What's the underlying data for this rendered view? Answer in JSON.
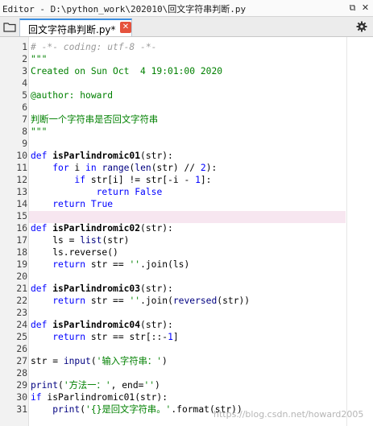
{
  "window": {
    "title": "Editor - D:\\python_work\\202010\\回文字符串判断.py",
    "undock_icon": "⧉",
    "close_icon": "✕"
  },
  "tab": {
    "label": "回文字符串判断.py*",
    "close_icon": "✕"
  },
  "icons": {
    "browse": "folder-icon",
    "options": "gear-icon"
  },
  "code": [
    {
      "n": "1",
      "segs": [
        {
          "t": "# -*- coding: utf-8 -*-",
          "c": "cm"
        }
      ]
    },
    {
      "n": "2",
      "segs": [
        {
          "t": "\"\"\"",
          "c": "st"
        }
      ]
    },
    {
      "n": "3",
      "segs": [
        {
          "t": "Created on Sun Oct  4 19:01:00 2020",
          "c": "st"
        }
      ]
    },
    {
      "n": "4",
      "segs": []
    },
    {
      "n": "5",
      "segs": [
        {
          "t": "@author: howard",
          "c": "st"
        }
      ]
    },
    {
      "n": "6",
      "segs": []
    },
    {
      "n": "7",
      "segs": [
        {
          "t": "判断一个字符串是否回文字符串",
          "c": "st"
        }
      ]
    },
    {
      "n": "8",
      "segs": [
        {
          "t": "\"\"\"",
          "c": "st"
        }
      ]
    },
    {
      "n": "9",
      "segs": []
    },
    {
      "n": "10",
      "segs": [
        {
          "t": "def ",
          "c": "kw"
        },
        {
          "t": "isParlindromic01",
          "c": "fn"
        },
        {
          "t": "(str):",
          "c": ""
        }
      ]
    },
    {
      "n": "11",
      "segs": [
        {
          "t": "    ",
          "c": ""
        },
        {
          "t": "for",
          "c": "kw"
        },
        {
          "t": " i ",
          "c": ""
        },
        {
          "t": "in",
          "c": "kw"
        },
        {
          "t": " ",
          "c": ""
        },
        {
          "t": "range",
          "c": "bi"
        },
        {
          "t": "(",
          "c": ""
        },
        {
          "t": "len",
          "c": "bi"
        },
        {
          "t": "(str) // ",
          "c": ""
        },
        {
          "t": "2",
          "c": "nm"
        },
        {
          "t": "):",
          "c": ""
        }
      ]
    },
    {
      "n": "12",
      "segs": [
        {
          "t": "        ",
          "c": ""
        },
        {
          "t": "if",
          "c": "kw"
        },
        {
          "t": " str[i] != str[-i - ",
          "c": ""
        },
        {
          "t": "1",
          "c": "nm"
        },
        {
          "t": "]:",
          "c": ""
        }
      ]
    },
    {
      "n": "13",
      "segs": [
        {
          "t": "            ",
          "c": ""
        },
        {
          "t": "return",
          "c": "kw"
        },
        {
          "t": " ",
          "c": ""
        },
        {
          "t": "False",
          "c": "kw"
        }
      ]
    },
    {
      "n": "14",
      "segs": [
        {
          "t": "    ",
          "c": ""
        },
        {
          "t": "return",
          "c": "kw"
        },
        {
          "t": " ",
          "c": ""
        },
        {
          "t": "True",
          "c": "kw"
        }
      ]
    },
    {
      "n": "15",
      "segs": []
    },
    {
      "n": "16",
      "segs": [
        {
          "t": "def ",
          "c": "kw"
        },
        {
          "t": "isParlindromic02",
          "c": "fn"
        },
        {
          "t": "(str):",
          "c": ""
        }
      ]
    },
    {
      "n": "17",
      "segs": [
        {
          "t": "    ls = ",
          "c": ""
        },
        {
          "t": "list",
          "c": "bi"
        },
        {
          "t": "(str)",
          "c": ""
        }
      ]
    },
    {
      "n": "18",
      "segs": [
        {
          "t": "    ls.reverse()",
          "c": ""
        }
      ]
    },
    {
      "n": "19",
      "segs": [
        {
          "t": "    ",
          "c": ""
        },
        {
          "t": "return",
          "c": "kw"
        },
        {
          "t": " str == ",
          "c": ""
        },
        {
          "t": "''",
          "c": "st"
        },
        {
          "t": ".join(ls)",
          "c": ""
        }
      ]
    },
    {
      "n": "20",
      "segs": []
    },
    {
      "n": "21",
      "segs": [
        {
          "t": "def ",
          "c": "kw"
        },
        {
          "t": "isParlindromic03",
          "c": "fn"
        },
        {
          "t": "(str):",
          "c": ""
        }
      ]
    },
    {
      "n": "22",
      "segs": [
        {
          "t": "    ",
          "c": ""
        },
        {
          "t": "return",
          "c": "kw"
        },
        {
          "t": " str == ",
          "c": ""
        },
        {
          "t": "''",
          "c": "st"
        },
        {
          "t": ".join(",
          "c": ""
        },
        {
          "t": "reversed",
          "c": "bi"
        },
        {
          "t": "(str))",
          "c": ""
        }
      ]
    },
    {
      "n": "23",
      "segs": []
    },
    {
      "n": "24",
      "segs": [
        {
          "t": "def ",
          "c": "kw"
        },
        {
          "t": "isParlindromic04",
          "c": "fn"
        },
        {
          "t": "(str):",
          "c": ""
        }
      ]
    },
    {
      "n": "25",
      "segs": [
        {
          "t": "    ",
          "c": ""
        },
        {
          "t": "return",
          "c": "kw"
        },
        {
          "t": " str == str[::-",
          "c": ""
        },
        {
          "t": "1",
          "c": "nm"
        },
        {
          "t": "]",
          "c": ""
        }
      ]
    },
    {
      "n": "26",
      "segs": []
    },
    {
      "n": "27",
      "segs": [
        {
          "t": "str = ",
          "c": ""
        },
        {
          "t": "input",
          "c": "bi"
        },
        {
          "t": "(",
          "c": ""
        },
        {
          "t": "'输入字符串：'",
          "c": "st"
        },
        {
          "t": ")",
          "c": ""
        }
      ]
    },
    {
      "n": "28",
      "segs": []
    },
    {
      "n": "29",
      "segs": [
        {
          "t": "print",
          "c": "bi"
        },
        {
          "t": "(",
          "c": ""
        },
        {
          "t": "'方法一：'",
          "c": "st"
        },
        {
          "t": ", end=",
          "c": ""
        },
        {
          "t": "''",
          "c": "st"
        },
        {
          "t": ")",
          "c": ""
        }
      ]
    },
    {
      "n": "30",
      "segs": [
        {
          "t": "if",
          "c": "kw"
        },
        {
          "t": " isParlindromic01(str):",
          "c": ""
        }
      ]
    },
    {
      "n": "31",
      "segs": [
        {
          "t": "    ",
          "c": ""
        },
        {
          "t": "print",
          "c": "bi"
        },
        {
          "t": "(",
          "c": ""
        },
        {
          "t": "'{}是回文字符串。'",
          "c": "st"
        },
        {
          "t": ".format(str))",
          "c": ""
        }
      ]
    }
  ],
  "watermark": "https://blog.csdn.net/howard2005"
}
